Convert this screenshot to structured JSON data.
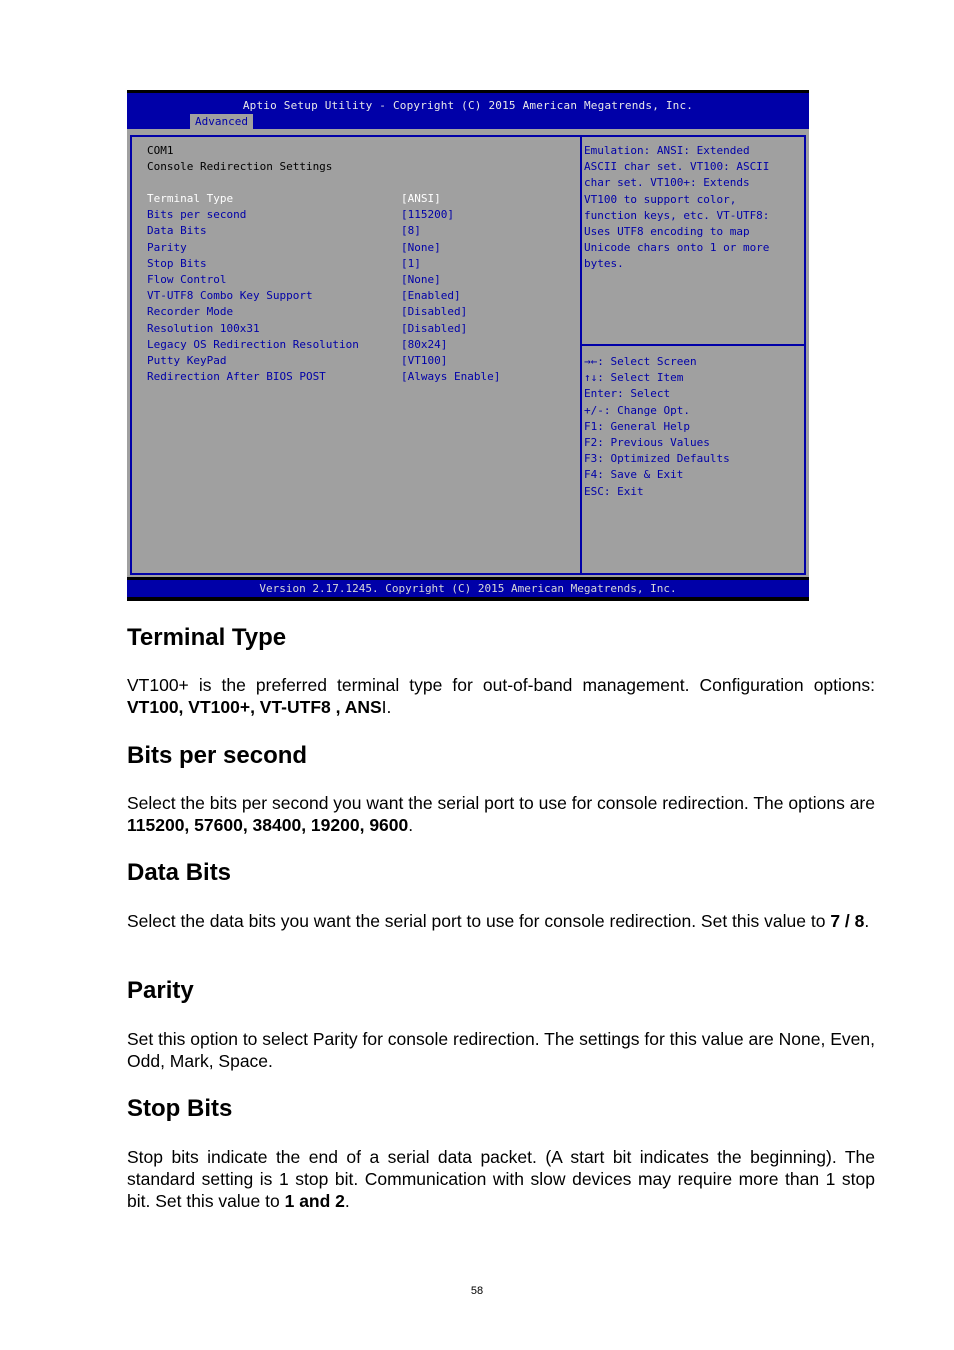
{
  "bios": {
    "title": "Aptio Setup Utility - Copyright (C) 2015 American Megatrends, Inc.",
    "active_tab": "Advanced",
    "header_lines": [
      "COM1",
      "Console Redirection Settings"
    ],
    "settings": [
      {
        "label": "Terminal Type",
        "value": "[ANSI]",
        "selected": true
      },
      {
        "label": "Bits per second",
        "value": "[115200]"
      },
      {
        "label": "Data Bits",
        "value": "[8]"
      },
      {
        "label": "Parity",
        "value": "[None]"
      },
      {
        "label": "Stop Bits",
        "value": "[1]"
      },
      {
        "label": "Flow Control",
        "value": "[None]"
      },
      {
        "label": "VT-UTF8 Combo Key Support",
        "value": "[Enabled]"
      },
      {
        "label": "Recorder Mode",
        "value": "[Disabled]"
      },
      {
        "label": "Resolution 100x31",
        "value": "[Disabled]"
      },
      {
        "label": "Legacy OS Redirection Resolution",
        "value": "[80x24]"
      },
      {
        "label": "Putty KeyPad",
        "value": "[VT100]"
      },
      {
        "label": "Redirection After BIOS POST",
        "value": "[Always Enable]"
      }
    ],
    "help_text": [
      "Emulation: ANSI: Extended",
      "ASCII char set. VT100: ASCII",
      "char set. VT100+: Extends",
      "VT100 to support color,",
      "function keys, etc. VT-UTF8:",
      "Uses UTF8 encoding to map",
      "Unicode chars onto 1 or more",
      "bytes."
    ],
    "key_help": [
      "→←: Select Screen",
      "↑↓: Select Item",
      "Enter: Select",
      "+/-: Change Opt.",
      "F1: General Help",
      "F2: Previous Values",
      "F3: Optimized Defaults",
      "F4: Save & Exit",
      "ESC: Exit"
    ],
    "version": "Version 2.17.1245. Copyright (C) 2015 American Megatrends, Inc."
  },
  "sections": [
    {
      "heading": "Terminal Type",
      "text_before": "VT100+ is the preferred terminal type for out-of-band management. Configuration options: ",
      "bold": "VT100, VT100+, VT-UTF8 , ANS",
      "text_after": "I."
    },
    {
      "heading": "Bits per second",
      "text_before": "Select the bits per second you want the serial port to use for console redirection. The options are ",
      "bold": "115200, 57600, 38400, 19200, 9600",
      "text_after": "."
    },
    {
      "heading": "Data Bits",
      "text_before": "Select the data bits you want the serial port to use for console redirection. Set this value to ",
      "bold": "7 / 8",
      "text_after": "."
    },
    {
      "heading": "Parity",
      "text_before": "Set this option to select Parity for console redirection. The settings for this value are None, Even, Odd, Mark, Space.",
      "bold": "",
      "text_after": ""
    },
    {
      "heading": "Stop Bits",
      "text_before": "Stop bits indicate the end of a serial data packet. (A start bit indicates the beginning). The standard setting is 1 stop bit. Communication with slow devices may require more than 1 stop bit. Set this value to ",
      "bold": "1 and 2",
      "text_after": "."
    }
  ],
  "page_number": "58"
}
